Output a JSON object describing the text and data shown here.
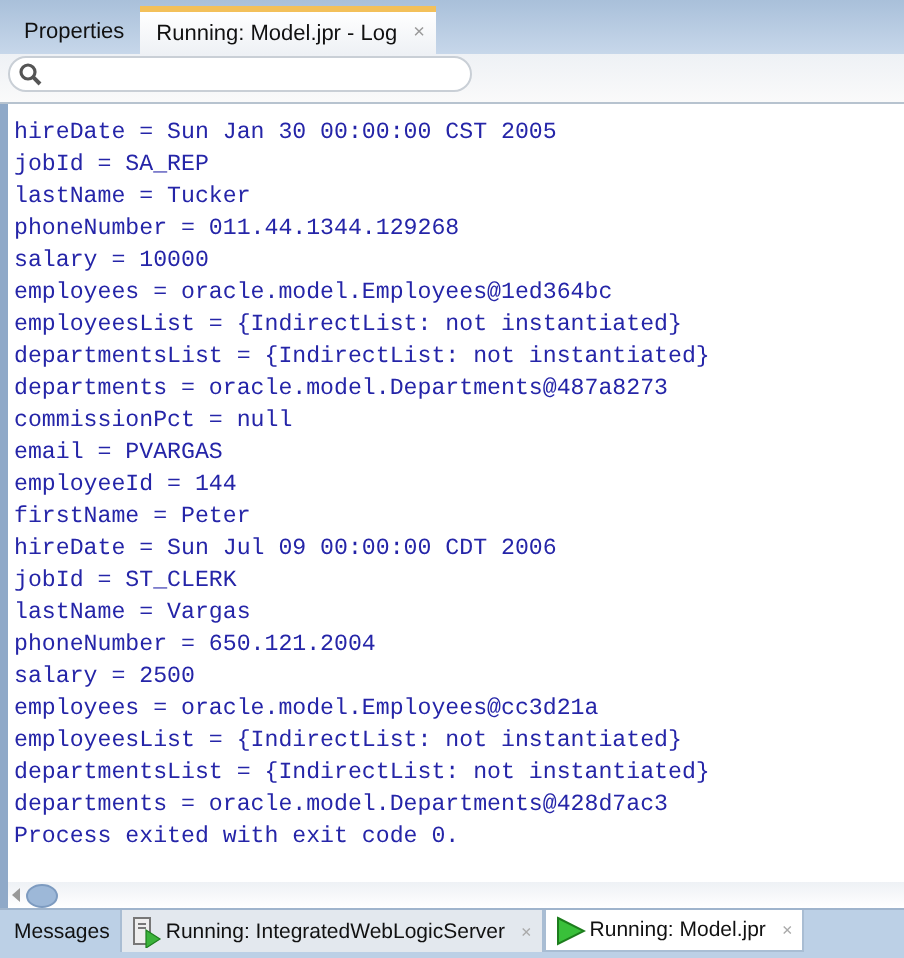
{
  "top_tabs": [
    {
      "label": "Properties",
      "selected": false
    },
    {
      "label": "Running: Model.jpr - Log",
      "selected": true,
      "close": "×"
    }
  ],
  "log_lines": [
    "hireDate = Sun Jan 30 00:00:00 CST 2005",
    "jobId = SA_REP",
    "lastName = Tucker",
    "phoneNumber = 011.44.1344.129268",
    "salary = 10000",
    "employees = oracle.model.Employees@1ed364bc",
    "employeesList = {IndirectList: not instantiated}",
    "departmentsList = {IndirectList: not instantiated}",
    "departments = oracle.model.Departments@487a8273",
    "commissionPct = null",
    "email = PVARGAS",
    "employeeId = 144",
    "firstName = Peter",
    "hireDate = Sun Jul 09 00:00:00 CDT 2006",
    "jobId = ST_CLERK",
    "lastName = Vargas",
    "phoneNumber = 650.121.2004",
    "salary = 2500",
    "employees = oracle.model.Employees@cc3d21a",
    "employeesList = {IndirectList: not instantiated}",
    "departmentsList = {IndirectList: not instantiated}",
    "departments = oracle.model.Departments@428d7ac3",
    "Process exited with exit code 0."
  ],
  "bottom_tabs": [
    {
      "label": "Messages",
      "kind": "plain",
      "selected": false
    },
    {
      "label": "Running: IntegratedWebLogicServer",
      "kind": "server",
      "selected": false,
      "close": "×"
    },
    {
      "label": "Running: Model.jpr",
      "kind": "run",
      "selected": true,
      "close": "×"
    }
  ]
}
